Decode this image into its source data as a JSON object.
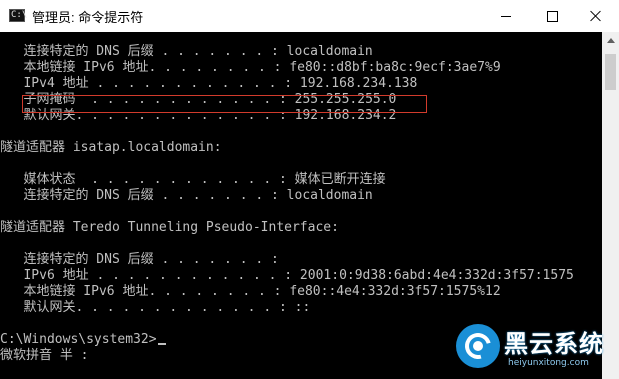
{
  "window": {
    "title": "管理员: 命令提示符",
    "icon_text": "C:\\",
    "controls": {
      "minimize_icon": "minimize-icon",
      "maximize_icon": "maximize-icon",
      "close_icon": "close-icon"
    }
  },
  "console": {
    "lines": [
      "   连接特定的 DNS 后缀 . . . . . . . : localdomain",
      "   本地链接 IPv6 地址. . . . . . . . : fe80::d8bf:ba8c:9ecf:3ae7%9",
      "   IPv4 地址 . . . . . . . . . . . . : 192.168.234.138",
      "   子网掩码  . . . . . . . . . . . . : 255.255.255.0",
      "   默认网关. . . . . . . . . . . . . : 192.168.234.2",
      "",
      "隧道适配器 isatap.localdomain:",
      "",
      "   媒体状态  . . . . . . . . . . . . : 媒体已断开连接",
      "   连接特定的 DNS 后缀 . . . . . . . : localdomain",
      "",
      "隧道适配器 Teredo Tunneling Pseudo-Interface:",
      "",
      "   连接特定的 DNS 后缀 . . . . . . . :",
      "   IPv6 地址 . . . . . . . . . . . . : 2001:0:9d38:6abd:4e4:332d:3f57:1575",
      "   本地链接 IPv6 地址. . . . . . . . : fe80::4e4:332d:3f57:1575%12",
      "   默认网关. . . . . . . . . . . . . : ::",
      "",
      "C:\\Windows\\system32>",
      "微软拼音 半 :"
    ]
  },
  "watermark": {
    "title": "黑云系统",
    "url": "heiyunxitong.com"
  },
  "colors": {
    "console_bg": "#000000",
    "console_text": "#c0c0c0",
    "highlight": "#d23b2c",
    "watermark_blue": "#1a8fd6"
  }
}
